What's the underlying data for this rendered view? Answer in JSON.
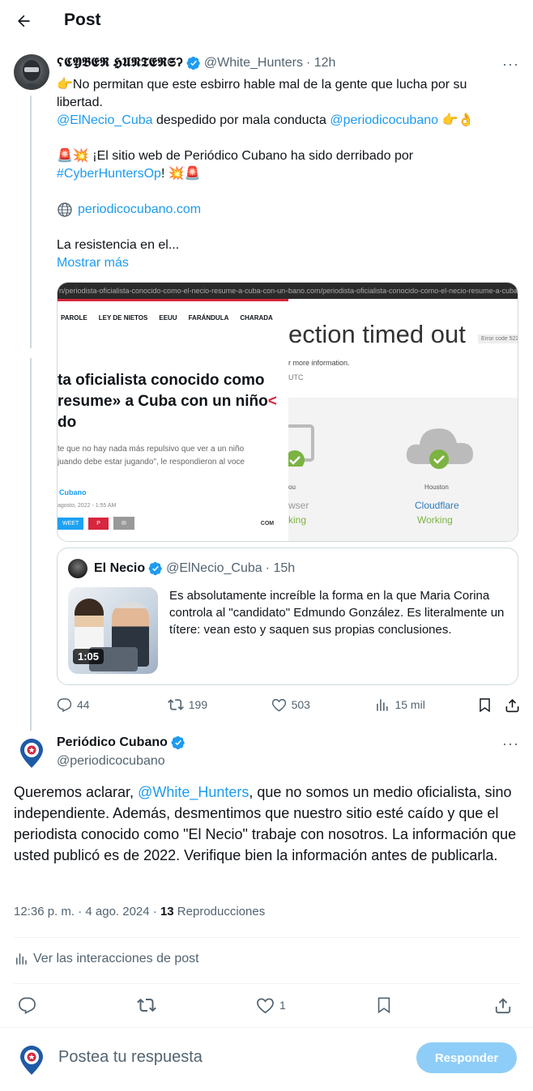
{
  "header": {
    "title": "Post"
  },
  "original_post": {
    "display_name": "𝕮𝖄𝕭𝕰𝕽 𝕳𝖀𝕹𝕿𝕰𝕽𝕾",
    "display_name_decor_left": "ʕ",
    "display_name_decor_right": "ʔ",
    "handle": "@White_Hunters",
    "time": "· 12h",
    "line1": "👉No permitan que este esbirro hable mal de la gente que lucha por su libertad.",
    "mention1": "@ElNecio_Cuba",
    "middle_text": " despedido por mala conducta ",
    "mention2": "@periodicocubano",
    "emoji_after": " 👉👌",
    "line3_prefix": "🚨💥 ¡El sitio web de Periódico Cubano ha sido derribado por",
    "hashtag": "#CyberHuntersOp",
    "line3_suffix": "! 💥🚨",
    "link_text": "periodicocubano.com",
    "truncated": "La resistencia en el...",
    "show_more": "Mostrar más",
    "stats": {
      "replies": "44",
      "reposts": "199",
      "likes": "503",
      "views": "15 mil"
    }
  },
  "media": {
    "left": {
      "url": "n/periodista-oficialista-conocido-como-el-necio-resume-a-cuba-con-un-niño",
      "nav": [
        "PAROLE",
        "LEY DE NIETOS",
        "EEUU",
        "FARÁNDULA",
        "CHARADA"
      ],
      "headline1": "ta oficialista conocido como",
      "headline2": "resume» a Cuba con un niño",
      "headline_arrow": "<",
      "headline3": "do",
      "lead1": "te que no hay nada más repulsivo que ver a un niño",
      "lead2": "juando debe estar jugando\", le respondieron al voce",
      "byline": "Cubano",
      "date": "agosto, 2022 - 1:55 AM",
      "share": [
        "WEET",
        "P",
        "✉"
      ],
      "comment": "COM"
    },
    "right": {
      "url": "bano.com/periodista-oficialista-conocido-como-el-necio-resume-a-cuba-con-un-niño",
      "title": "ection timed out",
      "error_code": "Error code 522",
      "more_info": "r more information.",
      "utc": "UTC",
      "you": "ou",
      "browser": "wser",
      "working_left": "king",
      "location": "Houston",
      "service": "Cloudflare",
      "working": "Working"
    }
  },
  "quote": {
    "name": "El Necio",
    "handle": "@ElNecio_Cuba",
    "time": "· 15h",
    "text": "Es absolutamente increíble la forma en la que Maria Corina controla al \"candidato\" Edmundo González. Es literalmente un títere: vean esto y saquen sus propias conclusiones.",
    "duration": "1:05"
  },
  "reply_post": {
    "name": "Periódico Cubano",
    "handle": "@periodicocubano",
    "text_prefix": "Queremos aclarar, ",
    "mention": "@White_Hunters",
    "text_rest": ", que no somos un medio oficialista, sino independiente. Además, desmentimos que nuestro sitio esté caído y que el periodista conocido como \"El Necio\" trabaje con nosotros. La información que usted publicó es de 2022. Verifique bien la información antes de publicarla.",
    "timestamp": "12:36 p. m. · 4 ago. 2024 · ",
    "views_count": "13",
    "views_label": " Reproducciones",
    "interactions": "Ver las interacciones de post",
    "likes": "1"
  },
  "composer": {
    "placeholder": "Postea tu respuesta",
    "button": "Responder"
  },
  "colors": {
    "accent": "#1d9bf0",
    "text": "#0f1419",
    "muted": "#536471",
    "border": "#cfd9de",
    "button_disabled": "#8ecdf7"
  }
}
